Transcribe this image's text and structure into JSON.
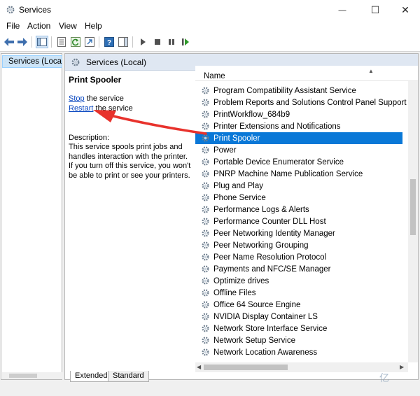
{
  "window": {
    "title": "Services",
    "minimize_glyph": "—",
    "maximize_glyph": "☐",
    "close_glyph": "✕"
  },
  "menu": [
    {
      "label": "File"
    },
    {
      "label": "Action"
    },
    {
      "label": "View"
    },
    {
      "label": "Help"
    }
  ],
  "toolbar": [
    "back-icon",
    "forward-icon",
    "show-console-tree-icon",
    "properties-icon",
    "refresh-icon",
    "export-list-icon",
    "help-icon",
    "action-pane-icon",
    "start-service-icon",
    "stop-service-icon",
    "pause-service-icon",
    "restart-service-icon"
  ],
  "tree": {
    "item_label": "Services (Loca"
  },
  "panel": {
    "header_title": "Services (Local)"
  },
  "detail": {
    "service_name": "Print Spooler",
    "stop_link": "Stop",
    "stop_suffix": " the service",
    "restart_link": "Restart",
    "restart_suffix": " the service",
    "description_heading": "Description:",
    "description": "This service spools print jobs and handles interaction with the printer. If you turn off this service, you won't be able to print or see your printers."
  },
  "list": {
    "column_header": "Name",
    "selected_index": 5,
    "rows": [
      "Program Compatibility Assistant Service",
      "Problem Reports and Solutions Control Panel Support",
      "PrintWorkflow_684b9",
      "Printer Extensions and Notifications",
      "Print Spooler",
      "Power",
      "Portable Device Enumerator Service",
      "PNRP Machine Name Publication Service",
      "Plug and Play",
      "Phone Service",
      "Performance Logs & Alerts",
      "Performance Counter DLL Host",
      "Peer Networking Identity Manager",
      "Peer Networking Grouping",
      "Peer Name Resolution Protocol",
      "Payments and NFC/SE Manager",
      "Optimize drives",
      "Offline Files",
      "Office 64 Source Engine",
      "NVIDIA Display Container LS",
      "Network Store Interface Service",
      "Network Setup Service",
      "Network Location Awareness"
    ]
  },
  "tabs": [
    {
      "label": "Extended"
    },
    {
      "label": "Standard"
    }
  ],
  "colors": {
    "selection": "#0a78d7",
    "annotation_arrow": "#e8322c",
    "link": "#0645c0"
  },
  "watermark": "亿"
}
